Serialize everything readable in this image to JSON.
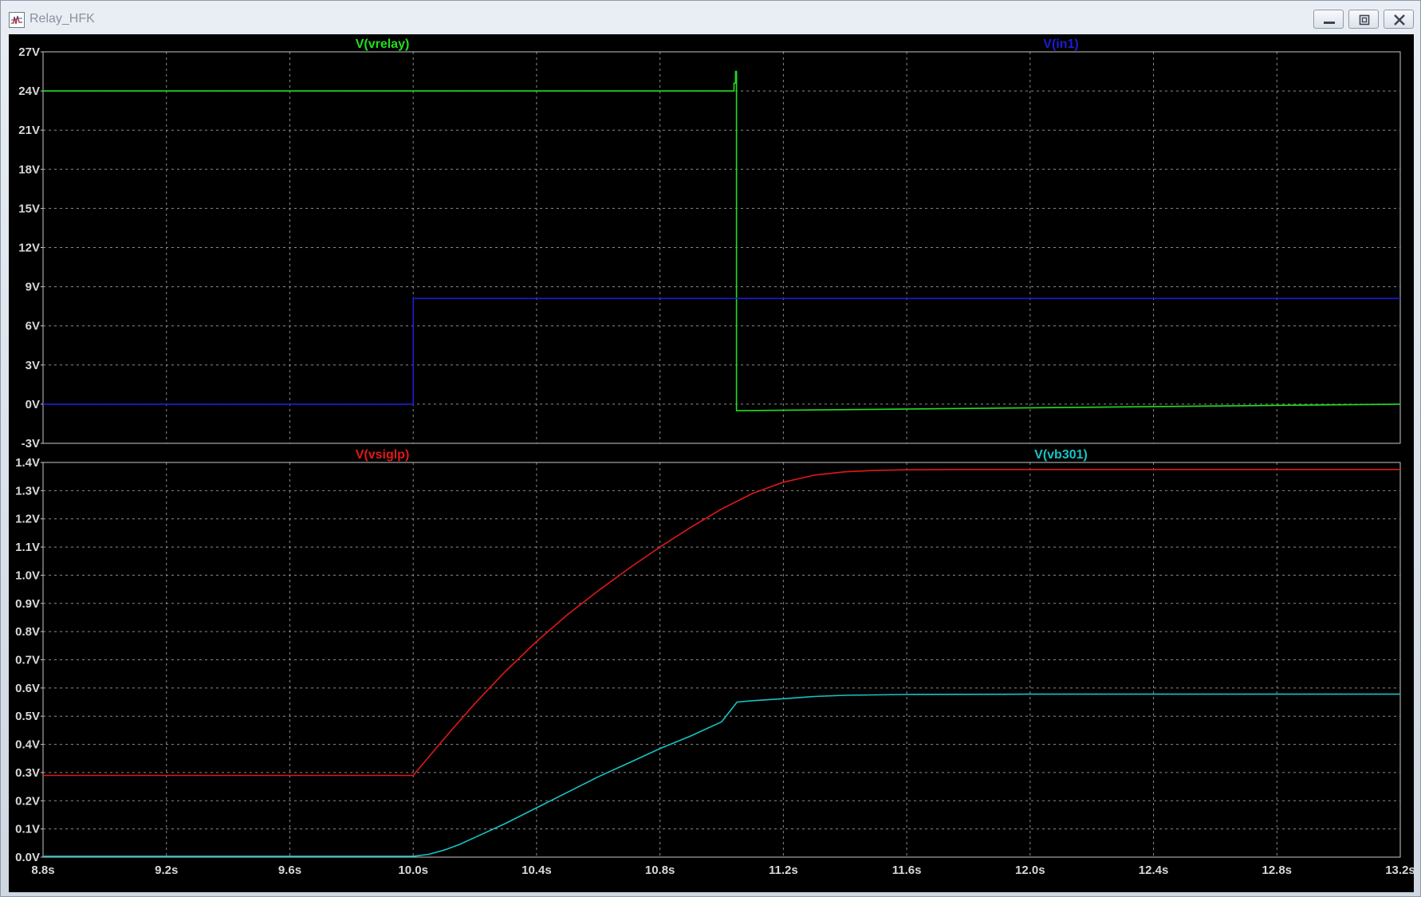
{
  "window": {
    "title": "Relay_HFK",
    "icon": "waveform-app-icon",
    "controls": [
      "minimize-icon",
      "restore-icon",
      "close-icon"
    ]
  },
  "colors": {
    "background": "#000000",
    "grid": "#8c8c8c",
    "axis_text": "#d8d8d8",
    "frame": "#c8c8c8"
  },
  "chart_data": [
    {
      "type": "line",
      "pane": "top",
      "xlim": [
        8.8,
        13.2
      ],
      "ylim": [
        -3,
        27
      ],
      "x_ticks": [
        8.8,
        9.2,
        9.6,
        10.0,
        10.4,
        10.8,
        11.2,
        11.6,
        12.0,
        12.4,
        12.8,
        13.2
      ],
      "y_ticks": [
        -3,
        0,
        3,
        6,
        9,
        12,
        15,
        18,
        21,
        24,
        27
      ],
      "y_tick_labels": [
        "-3V",
        "0V",
        "3V",
        "6V",
        "9V",
        "12V",
        "15V",
        "18V",
        "21V",
        "24V",
        "27V"
      ],
      "grid": true,
      "series": [
        {
          "name": "V(vrelay)",
          "color": "#22dd22",
          "label_position": "top-left",
          "x": [
            8.8,
            11.04,
            11.04,
            11.045,
            11.045,
            11.048,
            11.048,
            13.2
          ],
          "y": [
            24,
            24,
            24.6,
            24.6,
            25.5,
            25.5,
            -0.5,
            0
          ]
        },
        {
          "name": "V(in1)",
          "color": "#1c1cd8",
          "label_position": "top-right",
          "x": [
            8.8,
            10.0,
            10.0,
            13.2
          ],
          "y": [
            0,
            0,
            8.1,
            8.1
          ]
        }
      ]
    },
    {
      "type": "line",
      "pane": "bottom",
      "xlim": [
        8.8,
        13.2
      ],
      "ylim": [
        0,
        1.4
      ],
      "x_ticks": [
        8.8,
        9.2,
        9.6,
        10.0,
        10.4,
        10.8,
        11.2,
        11.6,
        12.0,
        12.4,
        12.8,
        13.2
      ],
      "x_tick_labels": [
        "8.8s",
        "9.2s",
        "9.6s",
        "10.0s",
        "10.4s",
        "10.8s",
        "11.2s",
        "11.6s",
        "12.0s",
        "12.4s",
        "12.8s",
        "13.2s"
      ],
      "y_ticks": [
        0,
        0.1,
        0.2,
        0.3,
        0.4,
        0.5,
        0.6,
        0.7,
        0.8,
        0.9,
        1.0,
        1.1,
        1.2,
        1.3,
        1.4
      ],
      "y_tick_labels": [
        "0.0V",
        "0.1V",
        "0.2V",
        "0.3V",
        "0.4V",
        "0.5V",
        "0.6V",
        "0.7V",
        "0.8V",
        "0.9V",
        "1.0V",
        "1.1V",
        "1.2V",
        "1.3V",
        "1.4V"
      ],
      "grid": true,
      "series": [
        {
          "name": "V(vsiglp)",
          "color": "#e01818",
          "label_position": "top-left",
          "x": [
            8.8,
            10.0,
            10.1,
            10.2,
            10.3,
            10.4,
            10.5,
            10.6,
            10.7,
            10.8,
            10.9,
            11.0,
            11.1,
            11.2,
            11.3,
            11.4,
            11.5,
            11.6,
            11.8,
            12.0,
            13.2
          ],
          "y": [
            0.29,
            0.29,
            0.42,
            0.545,
            0.66,
            0.765,
            0.86,
            0.945,
            1.025,
            1.1,
            1.17,
            1.235,
            1.29,
            1.33,
            1.355,
            1.367,
            1.372,
            1.374,
            1.375,
            1.375,
            1.375
          ]
        },
        {
          "name": "V(vb301)",
          "color": "#19c2c2",
          "label_position": "top-right",
          "x": [
            8.8,
            10.0,
            10.05,
            10.1,
            10.15,
            10.2,
            10.3,
            10.4,
            10.5,
            10.6,
            10.7,
            10.8,
            10.9,
            11.0,
            11.05,
            11.1,
            11.2,
            11.3,
            11.4,
            11.6,
            12.0,
            13.2
          ],
          "y": [
            0.003,
            0.003,
            0.01,
            0.025,
            0.045,
            0.07,
            0.12,
            0.175,
            0.23,
            0.285,
            0.335,
            0.385,
            0.43,
            0.48,
            0.55,
            0.555,
            0.562,
            0.57,
            0.574,
            0.577,
            0.578,
            0.578
          ]
        }
      ]
    }
  ]
}
